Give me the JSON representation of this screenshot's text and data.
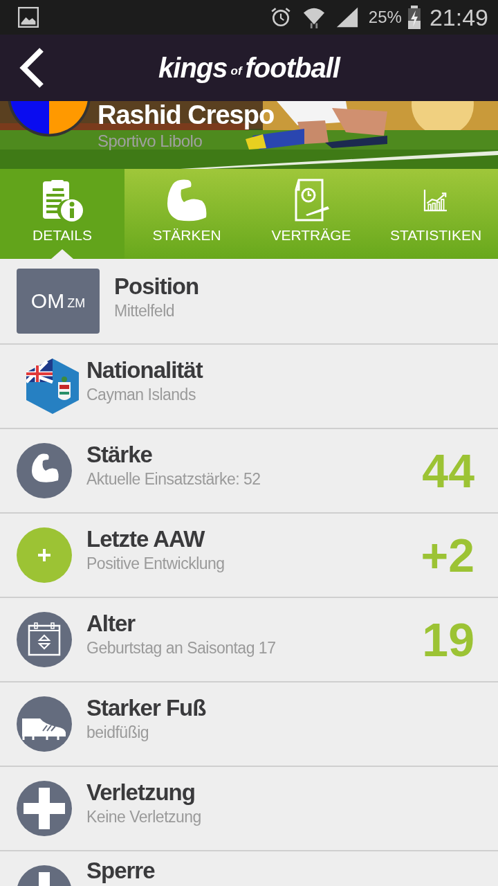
{
  "status_bar": {
    "battery": "25%",
    "time": "21:49"
  },
  "app_bar": {
    "logo": [
      "kings",
      "of",
      "football"
    ]
  },
  "player": {
    "name": "Rashid Crespo",
    "club": "Sportivo Libolo"
  },
  "tabs": [
    {
      "kind": "details",
      "label": "DETAILS",
      "selected": true
    },
    {
      "kind": "strength",
      "label": "STÄRKEN",
      "selected": false
    },
    {
      "kind": "contracts",
      "label": "VERTRÄGE",
      "selected": false
    },
    {
      "kind": "stats",
      "label": "STATISTIKEN",
      "selected": false
    }
  ],
  "rows": [
    {
      "kind": "position",
      "badge": "OM",
      "badge_sub": "ZM",
      "title": "Position",
      "subtitle": "Mittelfeld"
    },
    {
      "kind": "flag",
      "title": "Nationalität",
      "subtitle": "Cayman Islands"
    },
    {
      "kind": "muscle",
      "title": "Stärke",
      "subtitle": "Aktuelle Einsatzstärke: 52",
      "value": "44"
    },
    {
      "kind": "plus",
      "title": "Letzte AAW",
      "subtitle": "Positive Entwicklung",
      "value": "+2"
    },
    {
      "kind": "calendar",
      "title": "Alter",
      "subtitle": "Geburtstag an Saisontag 17",
      "value": "19"
    },
    {
      "kind": "boot",
      "title": "Starker Fuß",
      "subtitle": "beidfüßig"
    },
    {
      "kind": "cross",
      "title": "Verletzung",
      "subtitle": "Keine Verletzung"
    },
    {
      "kind": "cross",
      "title": "Sperre"
    }
  ]
}
